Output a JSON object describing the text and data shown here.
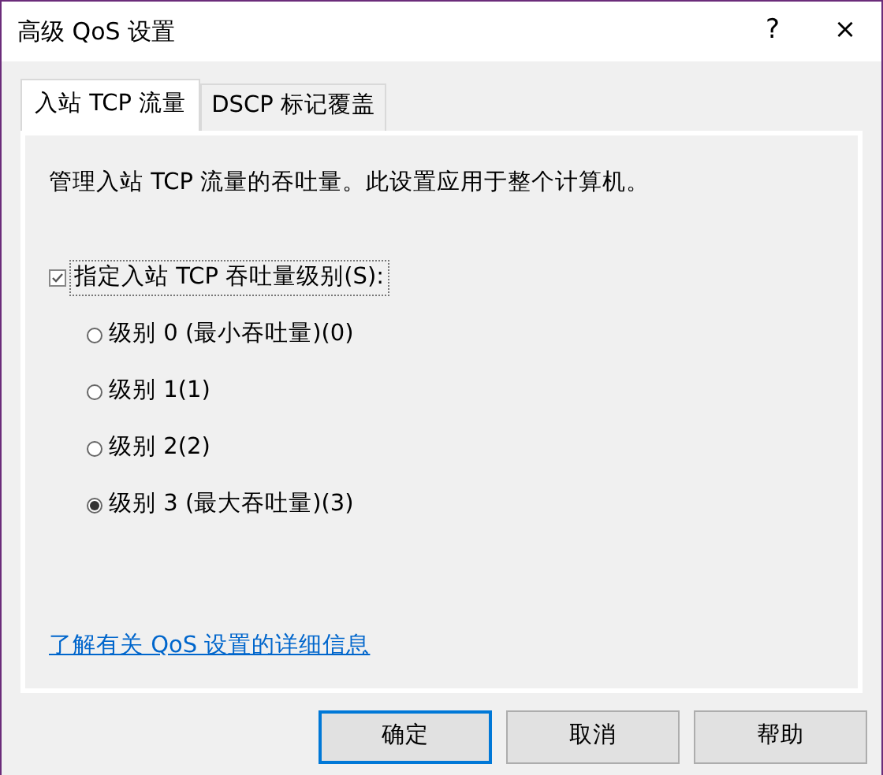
{
  "window": {
    "title": "高级 QoS 设置",
    "help": "?",
    "close": "×"
  },
  "tabs": [
    {
      "label": "入站 TCP 流量",
      "selected": true
    },
    {
      "label": "DSCP 标记覆盖",
      "selected": false
    }
  ],
  "description": "管理入站 TCP 流量的吞吐量。此设置应用于整个计算机。",
  "checkbox": {
    "label": "指定入站 TCP 吞吐量级别(S):",
    "checked": true
  },
  "radios": [
    {
      "label": "级别 0 (最小吞吐量)(0)",
      "selected": false
    },
    {
      "label": "级别 1(1)",
      "selected": false
    },
    {
      "label": "级别 2(2)",
      "selected": false
    },
    {
      "label": "级别 3 (最大吞吐量)(3)",
      "selected": true
    }
  ],
  "link": "了解有关 QoS 设置的详细信息",
  "buttons": [
    {
      "label": "确定",
      "default": true
    },
    {
      "label": "取消",
      "default": false
    },
    {
      "label": "帮助",
      "default": false
    }
  ]
}
